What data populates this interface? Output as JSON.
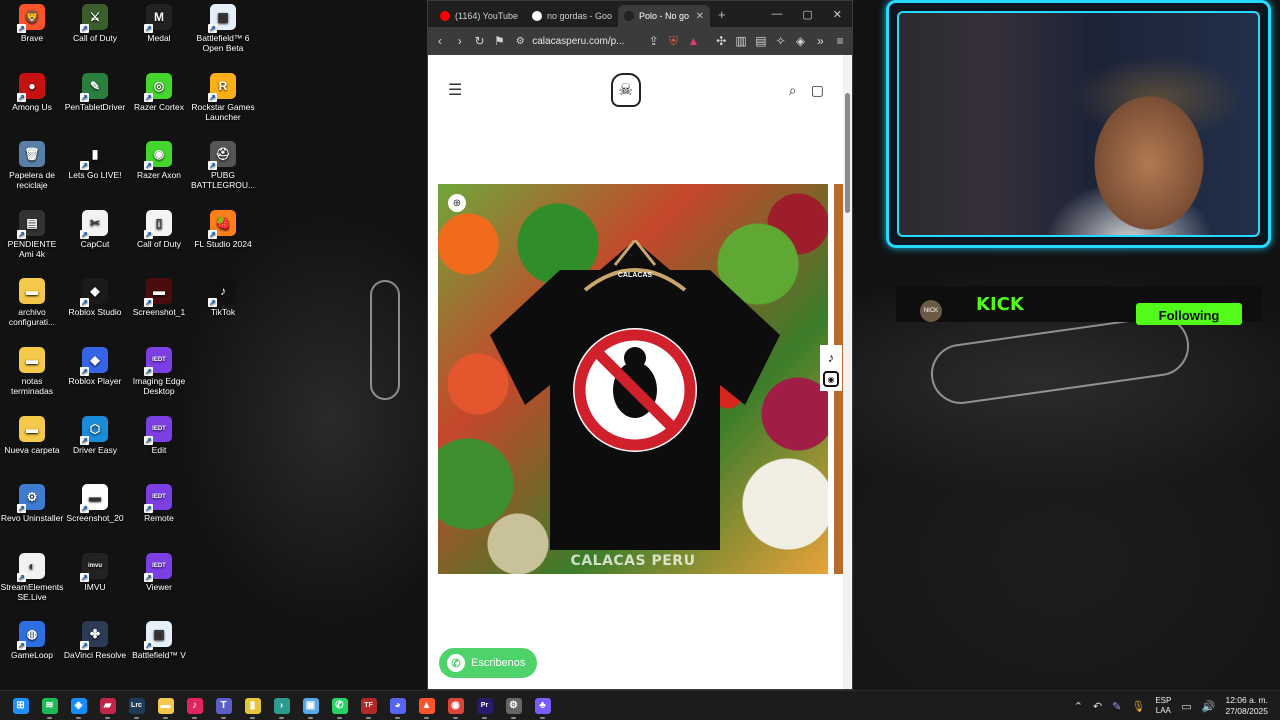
{
  "desktop": {
    "icons": [
      {
        "label": "Brave",
        "icon": "brave-icon",
        "color": "#fb542b",
        "glyph": "🦁"
      },
      {
        "label": "Call of Duty",
        "icon": "call-of-duty-icon",
        "color": "#3a5f2d",
        "glyph": "⚔"
      },
      {
        "label": "Medal",
        "icon": "medal-icon",
        "color": "#222222",
        "glyph": "M"
      },
      {
        "label": "Battlefield™ 6 Open Beta",
        "icon": "battlefield-icon",
        "color": "#e6f0fa",
        "glyph": "▦"
      },
      {
        "label": "Among Us",
        "icon": "among-us-icon",
        "color": "#c51111",
        "glyph": "●"
      },
      {
        "label": "PenTabletDriver",
        "icon": "pen-tablet-icon",
        "color": "#2a7f3f",
        "glyph": "✎"
      },
      {
        "label": "Razer Cortex",
        "icon": "razer-cortex-icon",
        "color": "#44d62c",
        "glyph": "◎"
      },
      {
        "label": "Rockstar Games Launcher",
        "icon": "rockstar-icon",
        "color": "#fcaf17",
        "glyph": "R"
      },
      {
        "label": "Papelera de reciclaje",
        "icon": "recycle-bin-icon",
        "color": "#5a7fa8",
        "glyph": "🗑"
      },
      {
        "label": "Lets Go LIVE!",
        "icon": "lets-go-live-icon",
        "color": "#111111",
        "glyph": "▮"
      },
      {
        "label": "Razer Axon",
        "icon": "razer-axon-icon",
        "color": "#44d62c",
        "glyph": "◉"
      },
      {
        "label": "PUBG BATTLEGROU...",
        "icon": "pubg-icon",
        "color": "#555555",
        "glyph": "⛑"
      },
      {
        "label": "PENDIENTE Ami 4k",
        "icon": "video-file-icon",
        "color": "#333333",
        "glyph": "▤"
      },
      {
        "label": "CapCut",
        "icon": "capcut-icon",
        "color": "#f2f2f2",
        "glyph": "✂"
      },
      {
        "label": "Call of Duty",
        "icon": "document-icon",
        "color": "#f4f4f4",
        "glyph": "▯"
      },
      {
        "label": "FL Studio 2024",
        "icon": "fl-studio-icon",
        "color": "#ff7f1a",
        "glyph": "🍓"
      },
      {
        "label": "archivo configurati...",
        "icon": "folder-icon",
        "color": "#f4c84a",
        "glyph": "▬"
      },
      {
        "label": "Roblox Studio",
        "icon": "roblox-studio-icon",
        "color": "#1a1a1a",
        "glyph": "◆"
      },
      {
        "label": "Screenshot_1",
        "icon": "image-file-icon",
        "color": "#4a0c0c",
        "glyph": "▬"
      },
      {
        "label": "TikTok",
        "icon": "tiktok-icon",
        "color": "#111111",
        "glyph": "♪"
      },
      {
        "label": "notas terminadas",
        "icon": "folder-icon",
        "color": "#f4c84a",
        "glyph": "▬"
      },
      {
        "label": "Roblox Player",
        "icon": "roblox-player-icon",
        "color": "#3365e6",
        "glyph": "◆"
      },
      {
        "label": "Imaging Edge Desktop",
        "icon": "imaging-edge-icon",
        "color": "#7b3fe4",
        "glyph": "IEDT"
      },
      {
        "label": "",
        "icon": "",
        "color": "",
        "glyph": ""
      },
      {
        "label": "Nueva carpeta",
        "icon": "folder-icon",
        "color": "#f4c84a",
        "glyph": "▬"
      },
      {
        "label": "Driver Easy",
        "icon": "driver-easy-icon",
        "color": "#1a8cd8",
        "glyph": "⬡"
      },
      {
        "label": "Edit",
        "icon": "imaging-edge-edit-icon",
        "color": "#7b3fe4",
        "glyph": "IEDT"
      },
      {
        "label": "",
        "icon": "",
        "color": "",
        "glyph": ""
      },
      {
        "label": "Revo Uninstaller",
        "icon": "revo-uninstaller-icon",
        "color": "#3f7ccf",
        "glyph": "⚙"
      },
      {
        "label": "Screenshot_20",
        "icon": "image-file-icon",
        "color": "#ffffff",
        "glyph": "▬"
      },
      {
        "label": "Remote",
        "icon": "imaging-edge-remote-icon",
        "color": "#7b3fe4",
        "glyph": "IEDT"
      },
      {
        "label": "",
        "icon": "",
        "color": "",
        "glyph": ""
      },
      {
        "label": "StreamElements SE.Live",
        "icon": "streamelements-icon",
        "color": "#f2f2f2",
        "glyph": "◐"
      },
      {
        "label": "IMVU",
        "icon": "imvu-icon",
        "color": "#222222",
        "glyph": "imvu"
      },
      {
        "label": "Viewer",
        "icon": "imaging-edge-viewer-icon",
        "color": "#7b3fe4",
        "glyph": "IEDT"
      },
      {
        "label": "",
        "icon": "",
        "color": "",
        "glyph": ""
      },
      {
        "label": "GameLoop",
        "icon": "gameloop-icon",
        "color": "#2d6ee0",
        "glyph": "◍"
      },
      {
        "label": "DaVinci Resolve",
        "icon": "davinci-resolve-icon",
        "color": "#2b3a55",
        "glyph": "✤"
      },
      {
        "label": "Battlefield™ V",
        "icon": "battlefield-icon",
        "color": "#e6f0fa",
        "glyph": "▦"
      },
      {
        "label": "",
        "icon": "",
        "color": "",
        "glyph": ""
      }
    ]
  },
  "browser": {
    "tabs": [
      {
        "title": "(1164) YouTube",
        "icon": "youtube-icon",
        "color": "#ff0000",
        "active": false
      },
      {
        "title": "no gordas - Goo",
        "icon": "google-icon",
        "color": "#ffffff",
        "active": false
      },
      {
        "title": "Polo - No go",
        "icon": "calacas-icon",
        "color": "#222222",
        "active": true
      }
    ],
    "new_tab": "+",
    "window_controls": {
      "minimize": "—",
      "maximize": "▢",
      "close": "✕"
    },
    "url": "calacasperu.com/p...",
    "toolbar_icons": [
      "back-icon",
      "forward-icon",
      "reload-icon",
      "bookmark-icon",
      "site-info-icon",
      "share-icon",
      "brave-shield-icon",
      "brave-rewards-icon",
      "extensions-icon",
      "sidebar-icon",
      "wallet-icon",
      "leo-ai-icon",
      "vpn-icon",
      "more-icon",
      "menu-icon"
    ]
  },
  "site": {
    "logo_alt": "Calacas Peru skull logo",
    "product": {
      "shirt_tag": "CALACAS",
      "watermark": "CALACAS PERU"
    },
    "whatsapp_label": "Escribenos"
  },
  "stream": {
    "kick_logo": "KICK",
    "kick_channel": "NICK",
    "follow_label": "Following"
  },
  "taskbar": {
    "apps": [
      {
        "icon": "windows-start-icon",
        "color": "#1e90ff",
        "glyph": "⊞"
      },
      {
        "icon": "spotify-icon",
        "color": "#1db954",
        "glyph": "≋"
      },
      {
        "icon": "battlenet-icon",
        "color": "#148eff",
        "glyph": "◈"
      },
      {
        "icon": "obs-cam-icon",
        "color": "#c2254a",
        "glyph": "▰"
      },
      {
        "icon": "lightroom-icon",
        "color": "#1f3b5a",
        "glyph": "Lrc"
      },
      {
        "icon": "file-explorer-icon",
        "color": "#f4c84a",
        "glyph": "▬"
      },
      {
        "icon": "tiktok-live-icon",
        "color": "#e0245e",
        "glyph": "♪"
      },
      {
        "icon": "teams-icon",
        "color": "#5b5fc7",
        "glyph": "T"
      },
      {
        "icon": "notes-icon",
        "color": "#e8c537",
        "glyph": "▮"
      },
      {
        "icon": "terminal-icon",
        "color": "#2a9d8f",
        "glyph": "›"
      },
      {
        "icon": "photos-icon",
        "color": "#5aa9e6",
        "glyph": "▣"
      },
      {
        "icon": "whatsapp-icon",
        "color": "#25d366",
        "glyph": "✆"
      },
      {
        "icon": "tf-icon",
        "color": "#b02a2a",
        "glyph": "TF"
      },
      {
        "icon": "discord-icon",
        "color": "#5865f2",
        "glyph": "◕"
      },
      {
        "icon": "brave-icon",
        "color": "#fb542b",
        "glyph": "▲"
      },
      {
        "icon": "chrome-icon",
        "color": "#db4437",
        "glyph": "◉"
      },
      {
        "icon": "premiere-icon",
        "color": "#2a1a6e",
        "glyph": "Pr"
      },
      {
        "icon": "settings-icon",
        "color": "#666666",
        "glyph": "⚙"
      },
      {
        "icon": "gamepad-icon",
        "color": "#7b5cff",
        "glyph": "♣"
      }
    ],
    "lang_line1": "ESP",
    "lang_line2": "LAA",
    "time": "12:06 a. m.",
    "date": "27/08/2025"
  }
}
